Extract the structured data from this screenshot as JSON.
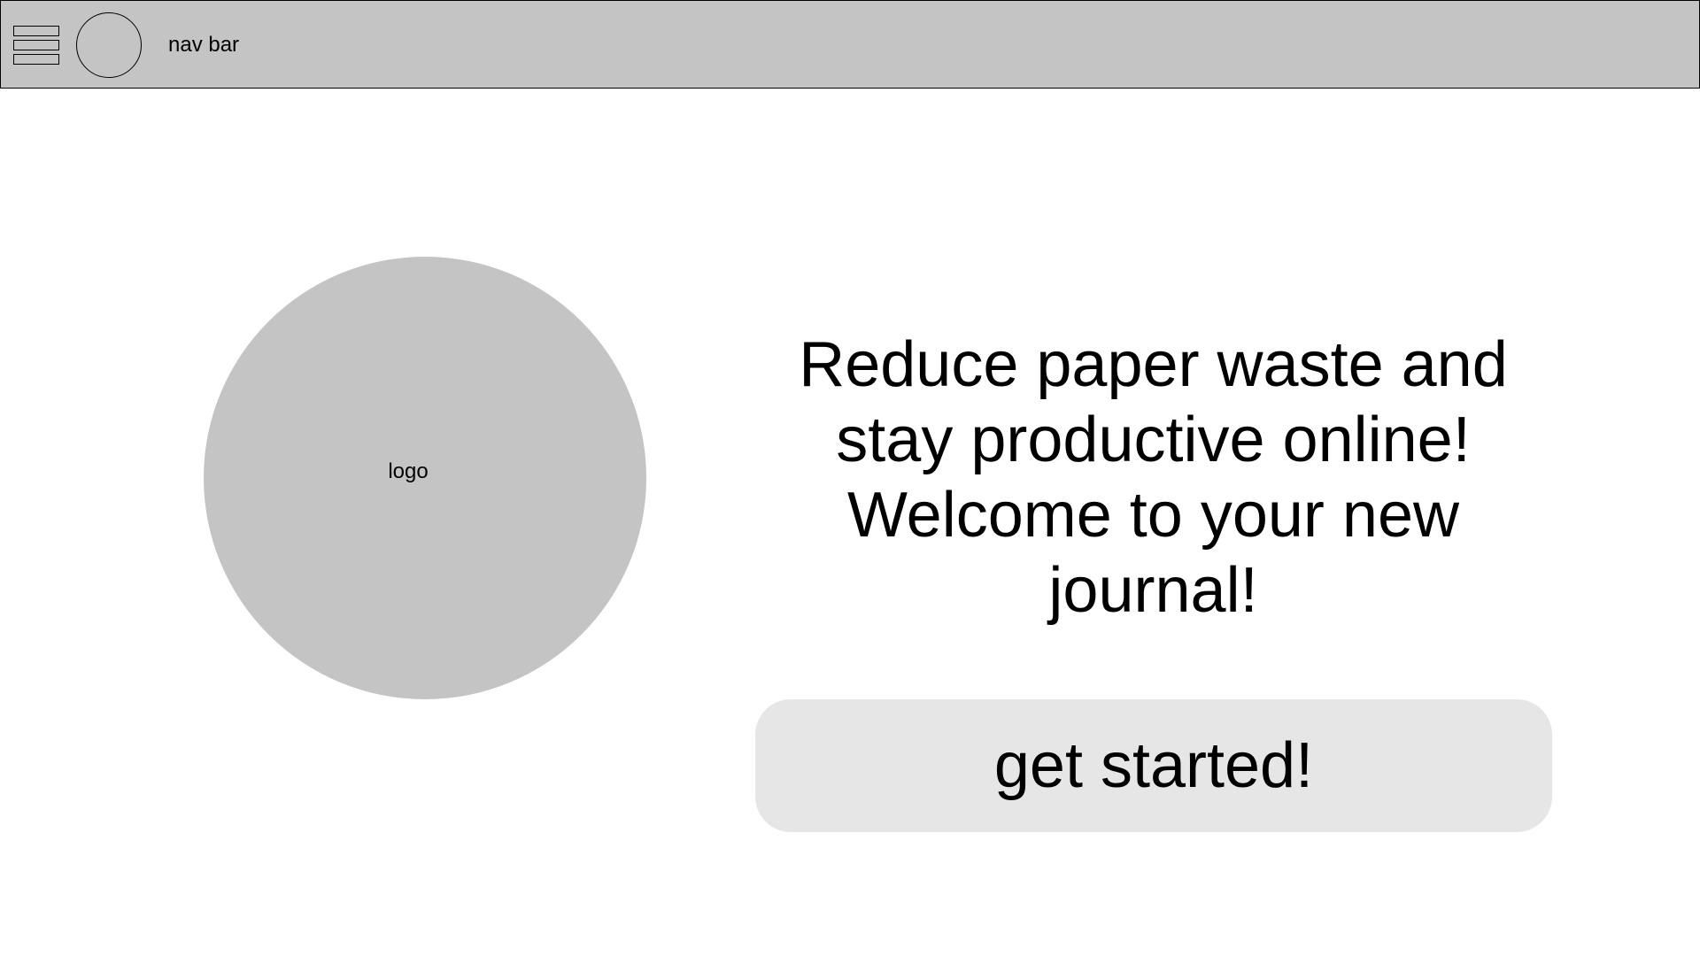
{
  "navbar": {
    "menu_icon": "hamburger-menu-icon",
    "avatar_icon": "circle-avatar-icon",
    "title": "nav bar",
    "background": "#c4c4c4"
  },
  "logo": {
    "label": "logo",
    "fill": "#c4c4c4"
  },
  "headline": {
    "lines": [
      "Reduce paper waste and",
      "stay productive online!",
      "Welcome to your new",
      "journal!"
    ]
  },
  "cta": {
    "label": "get started!",
    "background": "#e6e6e6"
  }
}
